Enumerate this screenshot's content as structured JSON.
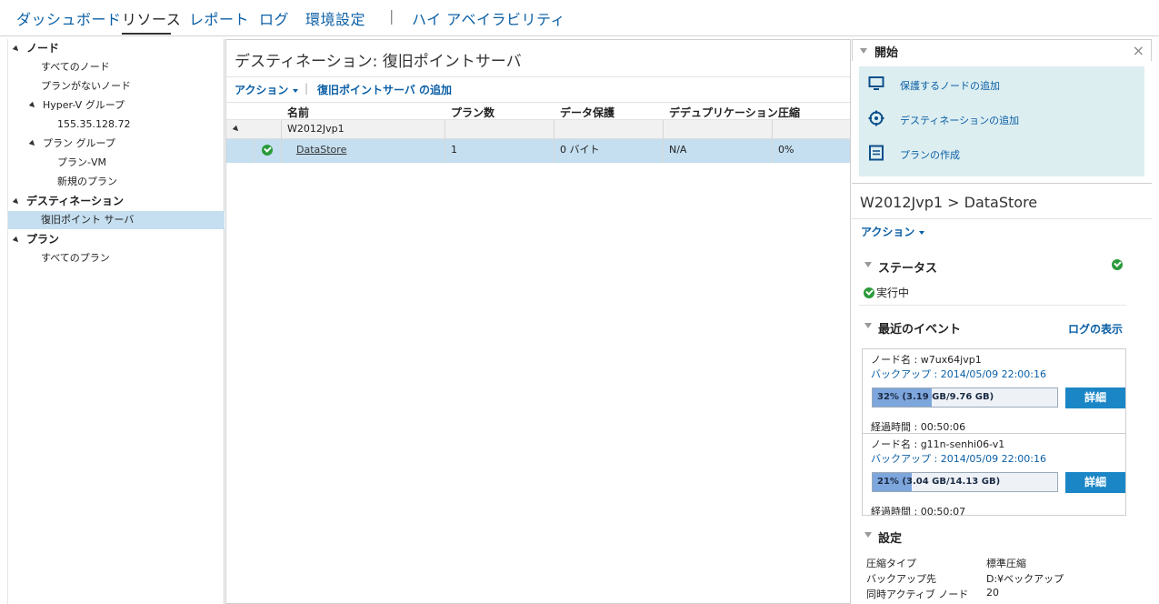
{
  "topnav": {
    "items": [
      "ダッシュボード",
      "リソース",
      "レポート",
      "ログ",
      "環境設定",
      "ハイ アベイラビリティ"
    ],
    "separator": "|",
    "active": "リソース"
  },
  "tree": {
    "nodes_header": "ノード",
    "all_nodes": "すべてのノード",
    "nodes_without_plan": "プランがないノード",
    "hyperv_group": "Hyper-V グループ",
    "hyperv_ip": "155.35.128.72",
    "plan_group": "プラン グループ",
    "plan_vm": "プラン-VM",
    "new_plan": "新規のプラン",
    "destination_header": "デスティネーション",
    "recovery_point_server": "復旧ポイント サーバ",
    "plan_header": "プラン",
    "all_plans": "すべてのプラン"
  },
  "center": {
    "title": "デスティネーション: 復旧ポイントサーバ",
    "toolbar": {
      "action": "アクション",
      "separator": "|",
      "add_rps": "復旧ポイントサーバ の追加"
    },
    "columns": [
      "名前",
      "プラン数",
      "データ保護",
      "デデュプリケーション",
      "圧縮"
    ],
    "group_name": "W2012Jvp1",
    "row": {
      "name": "DataStore",
      "plans": "1",
      "protected": "0 バイト",
      "dedup": "N/A",
      "compression": "0%"
    }
  },
  "right": {
    "start_title": "開始",
    "close": "×",
    "start_items": [
      "保護するノードの追加",
      "デスティネーションの追加",
      "プランの作成"
    ],
    "path": "W2012Jvp1 > DataStore",
    "action": "アクション",
    "status_title": "ステータス",
    "status_value": "実行中",
    "events_title": "最近のイベント",
    "view_logs": "ログの表示",
    "events": [
      {
        "node": "ノード名 : w7ux64jvp1",
        "backup": "バックアップ : 2014/05/09 22:00:16",
        "progress_text": "32% (3.19 GB/9.76 GB)",
        "progress": 32,
        "detail": "詳細",
        "elapsed": "経過時間 : 00:50:06"
      },
      {
        "node": "ノード名 : g11n-senhi06-v1",
        "backup": "バックアップ : 2014/05/09 22:00:16",
        "progress_text": "21% (3.04 GB/14.13 GB)",
        "progress": 21,
        "detail": "詳細",
        "elapsed": "経過時間 : 00:50:07"
      }
    ],
    "settings_title": "設定",
    "settings": [
      {
        "key": "圧縮タイプ",
        "value": "標準圧縮"
      },
      {
        "key": "バックアップ先",
        "value": "D:¥ベックアップ"
      },
      {
        "key": "同時アクティブ ノード",
        "value": "20"
      }
    ]
  },
  "colors": {
    "link": "#0b5fa5",
    "selected_row": "#c5dff0",
    "start_box": "#ddeef1",
    "ok_green": "#2a9a3a",
    "detail_button": "#1b86c6"
  }
}
